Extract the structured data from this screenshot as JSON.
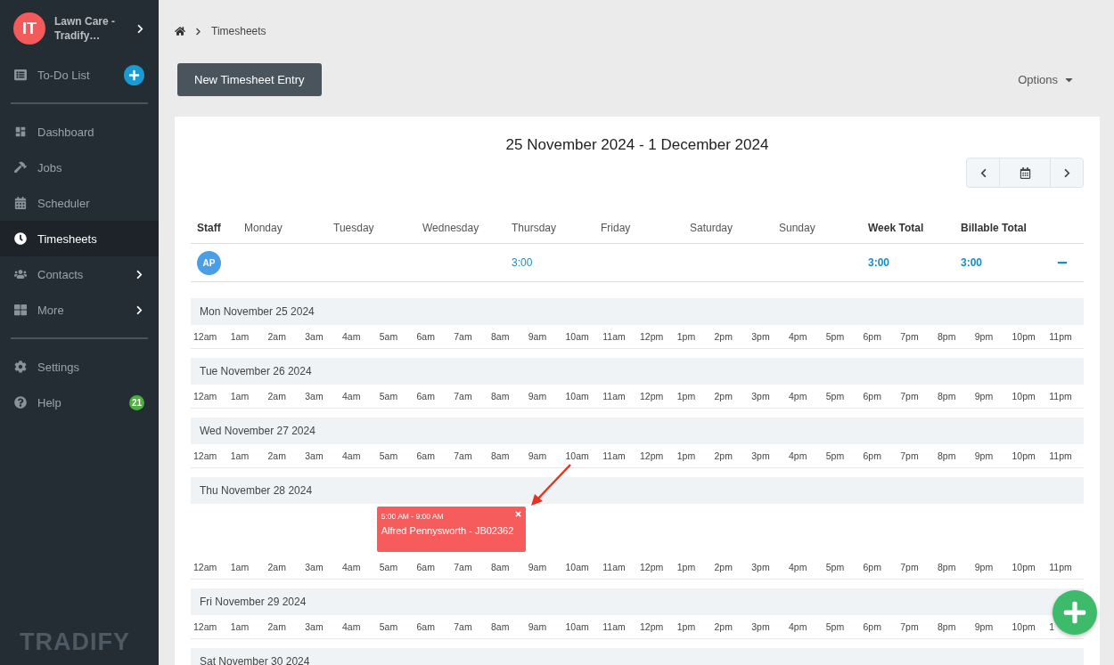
{
  "sidebar": {
    "account": {
      "initials": "IT",
      "name": "Lawn Care - Tradify…"
    },
    "todo": {
      "label": "To-Do List"
    },
    "items": [
      {
        "kind": "dashboard",
        "label": "Dashboard",
        "selected": false,
        "submenu": false
      },
      {
        "kind": "jobs",
        "label": "Jobs",
        "selected": false,
        "submenu": false
      },
      {
        "kind": "scheduler",
        "label": "Scheduler",
        "selected": false,
        "submenu": false
      },
      {
        "kind": "timesheets",
        "label": "Timesheets",
        "selected": true,
        "submenu": false
      },
      {
        "kind": "contacts",
        "label": "Contacts",
        "selected": false,
        "submenu": true
      },
      {
        "kind": "more",
        "label": "More",
        "selected": false,
        "submenu": true
      }
    ],
    "footer_items": [
      {
        "kind": "settings",
        "label": "Settings"
      },
      {
        "kind": "help",
        "label": "Help",
        "badge": "21"
      }
    ],
    "logo": "TRADIFY"
  },
  "breadcrumb": [
    "Timesheets"
  ],
  "toolbar": {
    "new_button": "New Timesheet Entry",
    "options": "Options"
  },
  "week": {
    "title": "25 November 2024 - 1 December 2024"
  },
  "staff_table": {
    "columns": [
      "Staff",
      "Monday",
      "Tuesday",
      "Wednesday",
      "Thursday",
      "Friday",
      "Saturday",
      "Sunday",
      "Week Total",
      "Billable Total"
    ],
    "rows": [
      {
        "cells": [
          "AP",
          "",
          "",
          "",
          "3:00",
          "",
          "",
          "",
          "3:00",
          "3:00"
        ],
        "expanded": true
      }
    ]
  },
  "days": [
    {
      "label": "Mon November 25 2024",
      "hours": [
        "12am",
        "1am",
        "2am",
        "3am",
        "4am",
        "5am",
        "6am",
        "7am",
        "8am",
        "9am",
        "10am",
        "11am",
        "12pm",
        "1pm",
        "2pm",
        "3pm",
        "4pm",
        "5pm",
        "6pm",
        "7pm",
        "8pm",
        "9pm",
        "10pm",
        "11pm"
      ]
    },
    {
      "label": "Tue November 26 2024",
      "hours": [
        "12am",
        "1am",
        "2am",
        "3am",
        "4am",
        "5am",
        "6am",
        "7am",
        "8am",
        "9am",
        "10am",
        "11am",
        "12pm",
        "1pm",
        "2pm",
        "3pm",
        "4pm",
        "5pm",
        "6pm",
        "7pm",
        "8pm",
        "9pm",
        "10pm",
        "11pm"
      ]
    },
    {
      "label": "Wed November 27 2024",
      "hours": [
        "12am",
        "1am",
        "2am",
        "3am",
        "4am",
        "5am",
        "6am",
        "7am",
        "8am",
        "9am",
        "10am",
        "11am",
        "12pm",
        "1pm",
        "2pm",
        "3pm",
        "4pm",
        "5pm",
        "6pm",
        "7pm",
        "8pm",
        "9pm",
        "10pm",
        "11pm"
      ]
    },
    {
      "label": "Thu November 28 2024",
      "events": [
        {
          "time": "5:00 AM - 9:00 AM",
          "title": "Alfred Pennysworth - JB02362"
        }
      ],
      "hours": [
        "12am",
        "1am",
        "2am",
        "3am",
        "4am",
        "5am",
        "6am",
        "7am",
        "8am",
        "9am",
        "10am",
        "11am",
        "12pm",
        "1pm",
        "2pm",
        "3pm",
        "4pm",
        "5pm",
        "6pm",
        "7pm",
        "8pm",
        "9pm",
        "10pm",
        "11pm"
      ]
    },
    {
      "label": "Fri November 29 2024",
      "hours": [
        "12am",
        "1am",
        "2am",
        "3am",
        "4am",
        "5am",
        "6am",
        "7am",
        "8am",
        "9am",
        "10am",
        "11am",
        "12pm",
        "1pm",
        "2pm",
        "3pm",
        "4pm",
        "5pm",
        "6pm",
        "7pm",
        "8pm",
        "9pm",
        "10pm",
        "1"
      ]
    },
    {
      "label": "Sat November 30 2024"
    }
  ]
}
